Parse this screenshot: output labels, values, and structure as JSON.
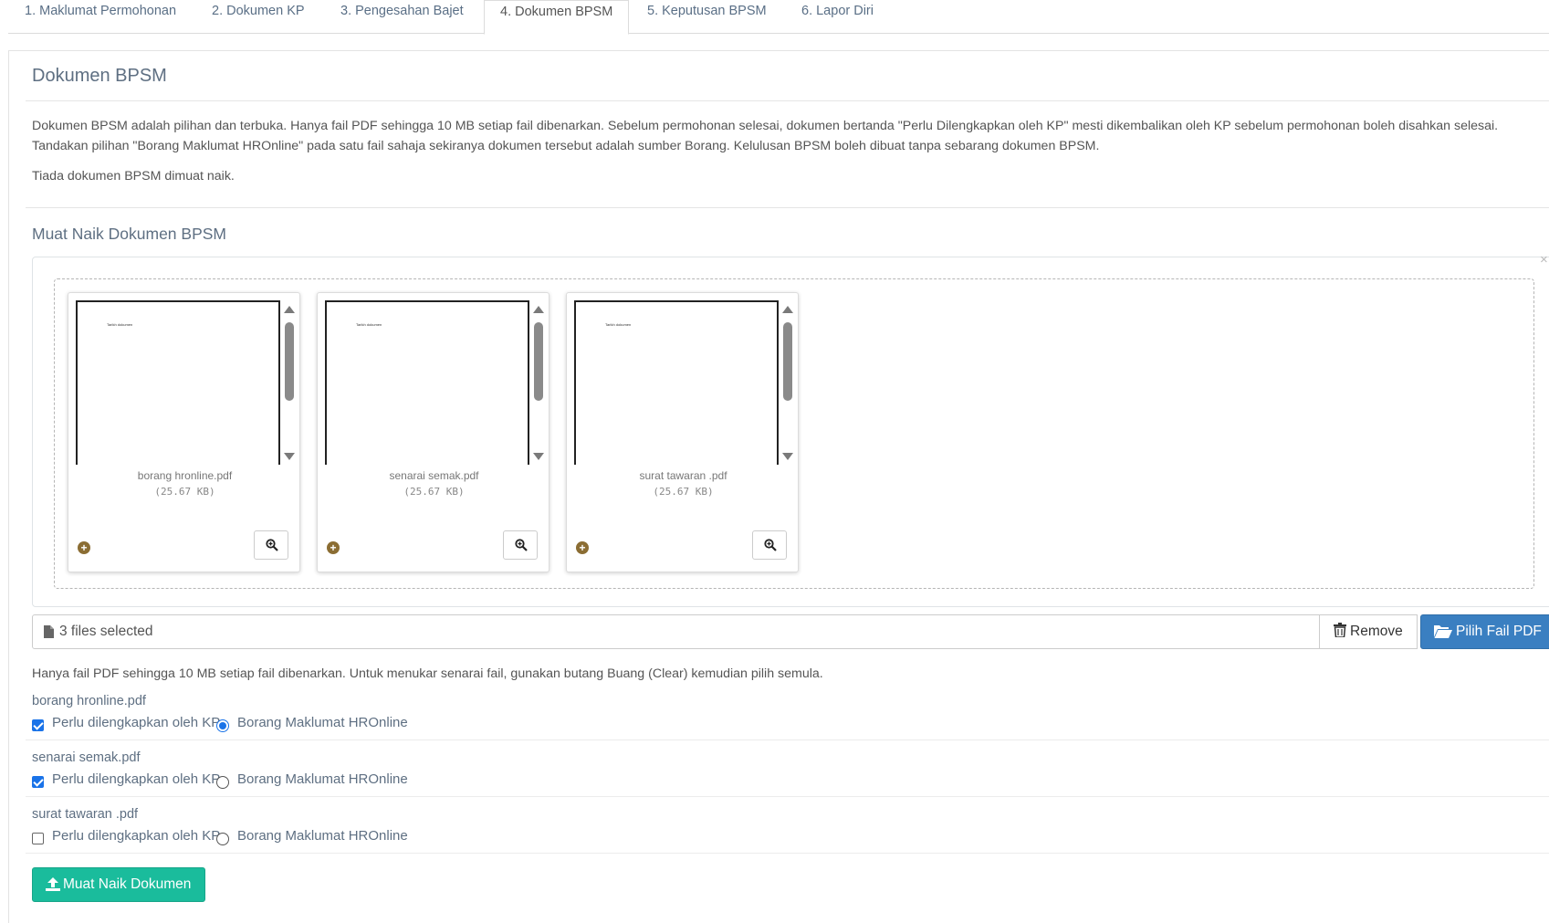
{
  "tabs": [
    {
      "label": "1. Maklumat Permohonan"
    },
    {
      "label": "2. Dokumen KP"
    },
    {
      "label": "3. Pengesahan Bajet"
    },
    {
      "label": "4. Dokumen BPSM"
    },
    {
      "label": "5. Keputusan BPSM"
    },
    {
      "label": "6. Lapor Diri"
    }
  ],
  "active_tab": "4. Dokumen BPSM",
  "section": {
    "title": "Dokumen BPSM",
    "description_line1": "Dokumen BPSM adalah pilihan dan terbuka. Hanya fail PDF sehingga 10 MB setiap fail dibenarkan. Sebelum permohonan selesai, dokumen bertanda \"Perlu Dilengkapkan oleh KP\" mesti dikembalikan oleh KP sebelum permohonan boleh disahkan selesai.",
    "description_line2": "Tandakan pilihan \"Borang Maklumat HROnline\" pada satu fail sahaja sekiranya dokumen tersebut adalah sumber Borang. Kelulusan BPSM boleh dibuat tanpa sebarang dokumen BPSM.",
    "empty_notice": "Tiada dokumen BPSM dimuat naik."
  },
  "upload": {
    "title": "Muat Naik Dokumen BPSM",
    "close_glyph": "×",
    "previews": [
      {
        "name": "borang hronline.pdf",
        "size": "(25.67 KB)",
        "page_text": "Tarikh dokumen"
      },
      {
        "name": "senarai semak.pdf",
        "size": "(25.67 KB)",
        "page_text": "Tarikh dokumen"
      },
      {
        "name": "surat tawaran .pdf",
        "size": "(25.67 KB)",
        "page_text": "Tarikh dokumen"
      }
    ],
    "selected_text": "3 files selected",
    "remove_label": "Remove",
    "choose_label": "Pilih Fail PDF",
    "help_text": "Hanya fail PDF sehingga 10 MB setiap fail dibenarkan. Untuk menukar senarai fail, gunakan butang Buang (Clear) kemudian pilih semula.",
    "files": [
      {
        "name": "borang hronline.pdf",
        "checkbox_label": "Perlu dilengkapkan oleh KP",
        "checkbox_checked": true,
        "radio_label": "Borang Maklumat HROnline",
        "radio_checked": true
      },
      {
        "name": "senarai semak.pdf",
        "checkbox_label": "Perlu dilengkapkan oleh KP",
        "checkbox_checked": true,
        "radio_label": "Borang Maklumat HROnline",
        "radio_checked": false
      },
      {
        "name": "surat tawaran .pdf",
        "checkbox_label": "Perlu dilengkapkan oleh KP",
        "checkbox_checked": false,
        "radio_label": "Borang Maklumat HROnline",
        "radio_checked": false
      }
    ],
    "submit_label": "Muat Naik Dokumen"
  },
  "colors": {
    "primary": "#3a7fc1",
    "success": "#1abc9c",
    "heading": "#5e6f82",
    "checkbox_accent": "#1a73e8"
  },
  "icons": [
    "file-icon",
    "trash-icon",
    "folder-open-icon",
    "upload-icon",
    "zoom-in-icon",
    "plus-circle-icon",
    "close-icon"
  ]
}
